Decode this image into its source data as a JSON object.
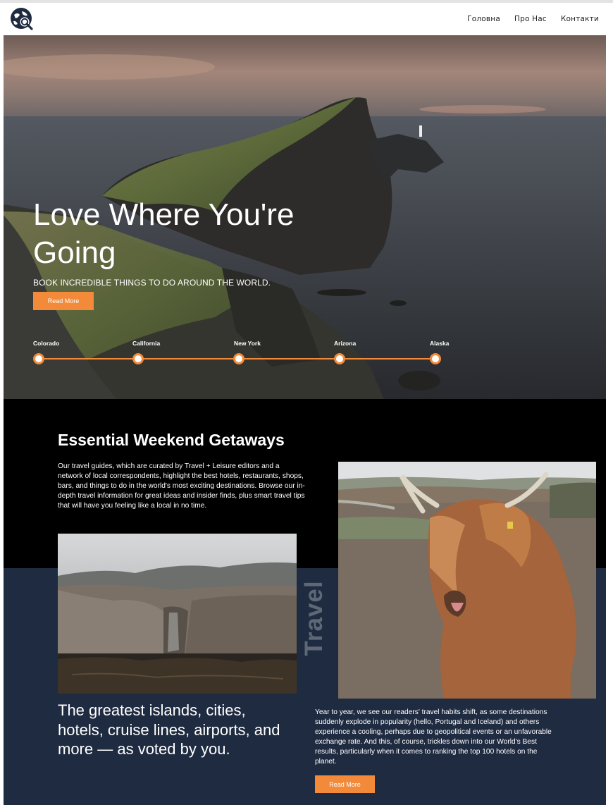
{
  "nav": {
    "items": [
      "Головна",
      "Про Нас",
      "Контакти"
    ],
    "logo_icon": "travel-search-icon"
  },
  "hero": {
    "title": "Love Where You're Going",
    "subtitle": "BOOK INCREDIBLE THINGS TO DO AROUND THE WORLD.",
    "button": "Read More",
    "timeline": [
      "Colorado",
      "California",
      "New York",
      "Arizona",
      "Alaska"
    ]
  },
  "section": {
    "title": "Essential Weekend Getaways",
    "text": "Our travel guides, which are curated by Travel + Leisure editors and a network of local correspondents, highlight the best hotels, restaurants, shops, bars, and things to do in the world's most exciting destinations. Browse our in-depth travel information for great ideas and insider finds, plus smart travel tips that will have you feeling like a local in no time.",
    "vertical_label": "Travel",
    "quote": "The greatest islands, cities, hotels, cruise lines, airports, and more — as voted by you.",
    "body": "Year to year, we see our readers' travel habits shift, as some destinations suddenly explode in popularity (hello, Portugal and Iceland) and others experience a cooling, perhaps due to geopolitical events or an unfavorable exchange rate. And this, of course, trickles down into our World's Best results, particularly when it comes to ranking the top 100 hotels on the planet.",
    "button": "Read More"
  },
  "colors": {
    "accent": "#f28a3a",
    "dark": "#000000",
    "navy": "#1f2b40"
  }
}
